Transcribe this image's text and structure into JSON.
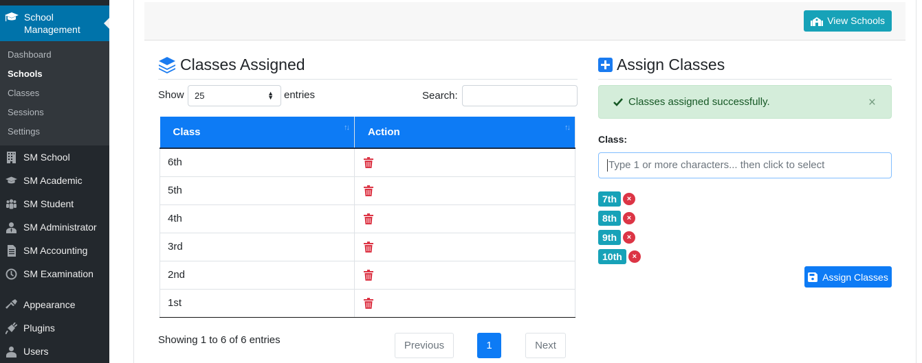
{
  "sidebar": {
    "current_menu": "School Management",
    "submenu": [
      {
        "label": "Dashboard",
        "active": false
      },
      {
        "label": "Schools",
        "active": true
      },
      {
        "label": "Classes",
        "active": false
      },
      {
        "label": "Sessions",
        "active": false
      },
      {
        "label": "Settings",
        "active": false
      }
    ],
    "items": [
      {
        "label": "SM School",
        "icon": "building-icon"
      },
      {
        "label": "SM Academic",
        "icon": "graduation-cap-icon"
      },
      {
        "label": "SM Student",
        "icon": "users-group-icon"
      },
      {
        "label": "SM Administrator",
        "icon": "user-tie-icon"
      },
      {
        "label": "SM Accounting",
        "icon": "document-icon"
      },
      {
        "label": "SM Examination",
        "icon": "clock-icon"
      },
      {
        "label": "Appearance",
        "icon": "paintbrush-icon"
      },
      {
        "label": "Plugins",
        "icon": "plugin-icon"
      },
      {
        "label": "Users",
        "icon": "user-icon"
      }
    ]
  },
  "header": {
    "view_schools_label": "View Schools"
  },
  "classes_assigned": {
    "title": "Classes Assigned",
    "show_label": "Show",
    "page_size": "25",
    "entries_label": "entries",
    "search_label": "Search:",
    "search_value": "",
    "columns": [
      "Class",
      "Action"
    ],
    "rows": [
      "6th",
      "5th",
      "4th",
      "3rd",
      "2nd",
      "1st"
    ],
    "info": "Showing 1 to 6 of 6 entries",
    "pagination": {
      "previous": "Previous",
      "current": "1",
      "next": "Next"
    }
  },
  "assign_classes": {
    "title": "Assign Classes",
    "alert": "Classes assigned successfully.",
    "alert_close": "×",
    "class_label": "Class:",
    "class_placeholder": "Type 1 or more characters... then click to select",
    "selected": [
      "7th",
      "8th",
      "9th",
      "10th"
    ],
    "remove_glyph": "×",
    "submit_label": "Assign Classes"
  },
  "colors": {
    "primary": "#0d7bf5",
    "info": "#17a2b8",
    "danger": "#dc3545",
    "success_bg": "#d4edda",
    "wp_blue": "#0073aa",
    "sidebar_bg": "#23282d"
  }
}
